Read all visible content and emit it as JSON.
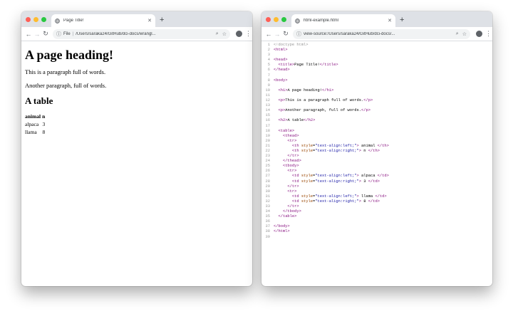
{
  "left_window": {
    "tab_title": "Page Title!",
    "url_scheme": "File",
    "url": "/Users/saraka24/GitHub/dci-docs/wrangl...",
    "page": {
      "h1": "A page heading!",
      "p1": "This is a paragraph full of words.",
      "p2": "Another paragraph, full of words.",
      "h2": "A table",
      "table": {
        "headers": [
          "animal",
          "n"
        ],
        "rows": [
          [
            "alpaca",
            "3"
          ],
          [
            "llama",
            "8"
          ]
        ]
      }
    }
  },
  "right_window": {
    "tab_title": "html-example.html",
    "url": "view-source:/Users/saraka24/GitHub/dci-docs/...",
    "source_lines": [
      "<!doctype html>",
      "<html>",
      "",
      "<head>",
      "  <title>Page Title!</title>",
      "</head>",
      "",
      "<body>",
      "",
      "  <h1>A page heading!</h1>",
      "",
      "  <p>This is a paragraph full of words.</p>",
      "",
      "  <p>Another paragraph, full of words.</p>",
      "",
      "  <h2>A table</h2>",
      "",
      "  <table>",
      "    <thead>",
      "      <tr>",
      "        <th style=\"text-align:left;\"> animal </th>",
      "        <th style=\"text-align:right;\"> n </th>",
      "      </tr>",
      "    </thead>",
      "    <tbody>",
      "      <tr>",
      "        <td style=\"text-align:left;\"> alpaca </td>",
      "        <td style=\"text-align:right;\"> 3 </td>",
      "      </tr>",
      "      <tr>",
      "        <td style=\"text-align:left;\"> llama </td>",
      "        <td style=\"text-align:right;\"> 8 </td>",
      "      </tr>",
      "    </tbody>",
      "  </table>",
      "",
      "</body>",
      "</html>",
      ""
    ]
  },
  "toolbar_icons": [
    "back-icon",
    "forward-icon",
    "reload-icon",
    "info-icon",
    "zoom-icon",
    "star-icon",
    "account-icon",
    "menu-icon"
  ],
  "colors": {
    "tag": "#881280",
    "attribute": "#994500",
    "string": "#1a1aa6",
    "comment": "#999999",
    "tabstrip": "#dee1e6"
  }
}
